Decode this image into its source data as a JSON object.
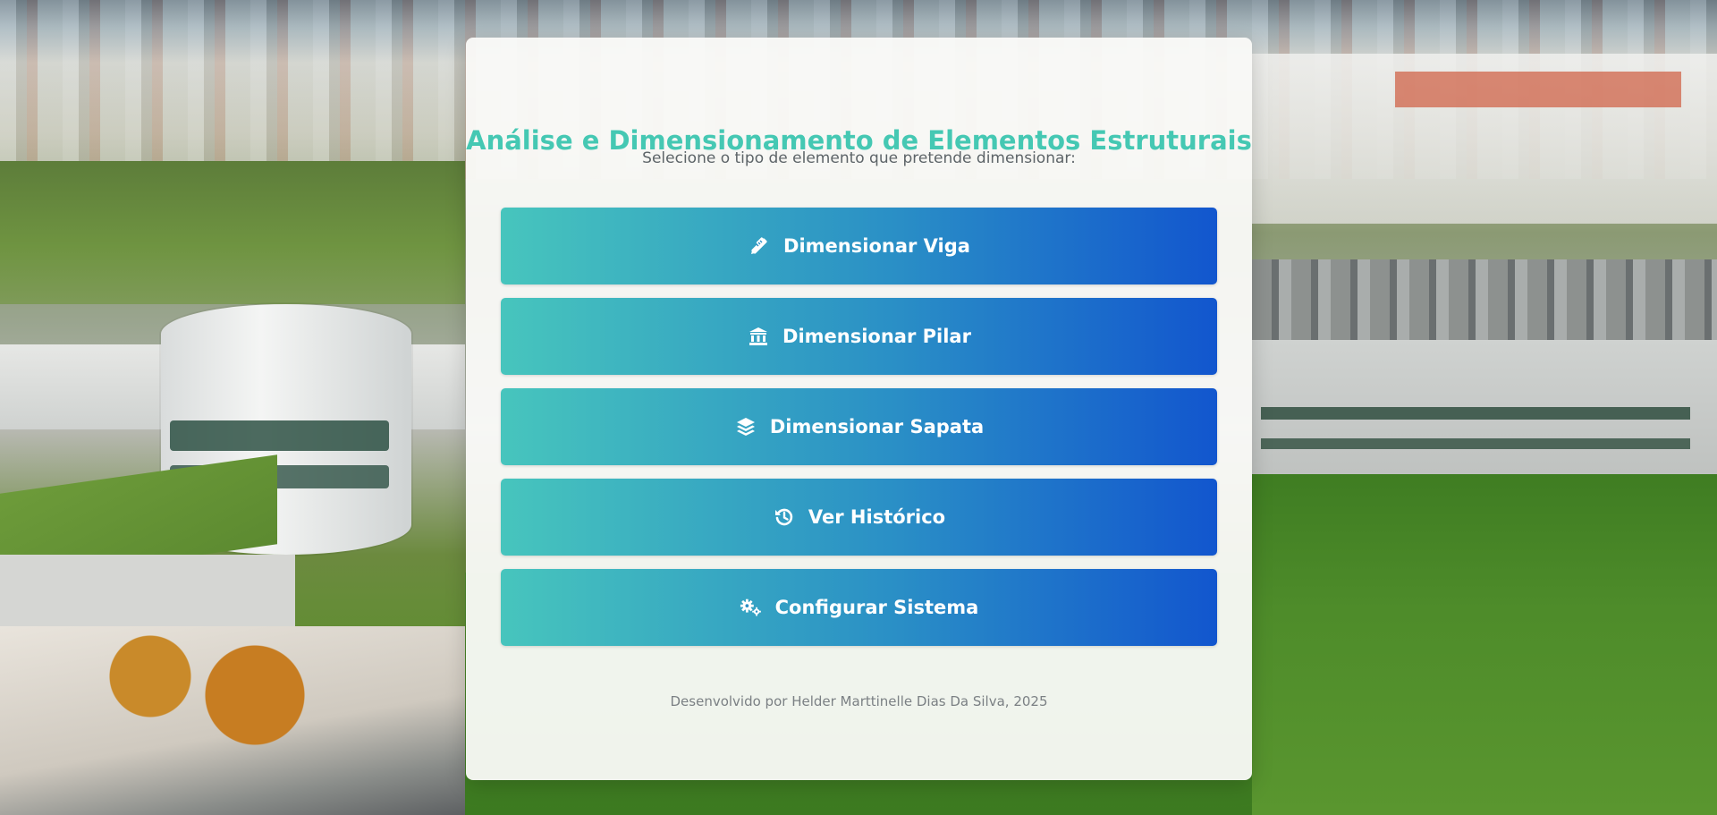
{
  "page": {
    "title": "Análise e Dimensionamento de Elementos Estruturais",
    "subtitle": "Selecione o tipo de elemento que pretende dimensionar:",
    "footer": "Desenvolvido por Helder Marttinelle Dias Da Silva, 2025"
  },
  "menu": {
    "items": [
      {
        "label": "Dimensionar Viga",
        "icon": "pencil-ruler-icon"
      },
      {
        "label": "Dimensionar Pilar",
        "icon": "columns-building-icon"
      },
      {
        "label": "Dimensionar Sapata",
        "icon": "layers-icon"
      },
      {
        "label": "Ver Histórico",
        "icon": "history-icon"
      },
      {
        "label": "Configurar Sistema",
        "icon": "gears-icon"
      }
    ]
  },
  "colors": {
    "title": "#45c8b3",
    "button_gradient_start": "#47c5bd",
    "button_gradient_end": "#1256ce",
    "subtitle": "#5d6468",
    "footer": "#7b8084"
  }
}
